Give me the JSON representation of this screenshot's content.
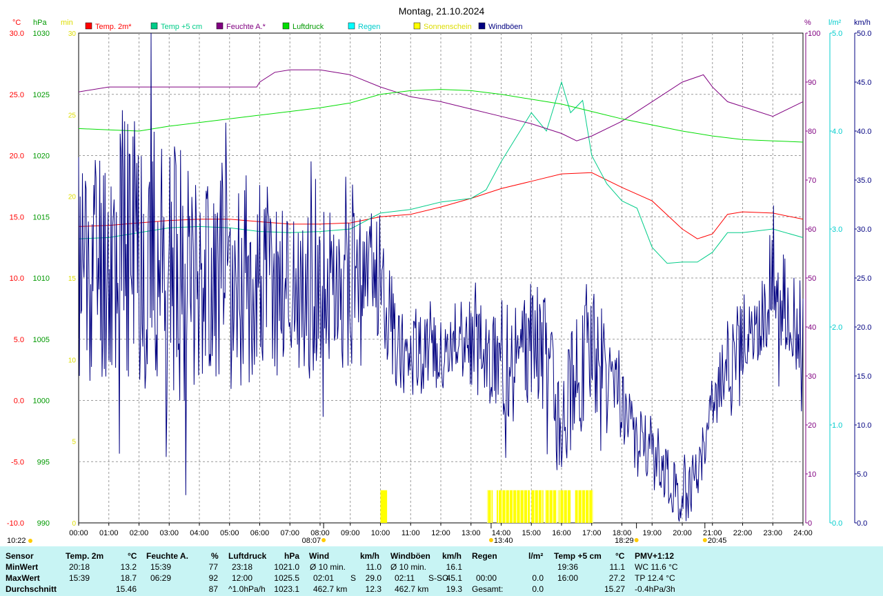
{
  "chart_data": {
    "type": "line",
    "title": "Montag, 21.10.2024",
    "x_ticks": [
      "00:00",
      "01:00",
      "02:00",
      "03:00",
      "04:00",
      "05:00",
      "06:00",
      "07:00",
      "08:00",
      "09:00",
      "10:00",
      "11:00",
      "12:00",
      "13:00",
      "14:00",
      "15:00",
      "16:00",
      "17:00",
      "18:00",
      "19:00",
      "20:00",
      "21:00",
      "22:00",
      "23:00",
      "24:00"
    ],
    "axes": {
      "temp": {
        "unit": "°C",
        "range": [
          -10,
          30
        ],
        "ticks": [
          "-10.0",
          "-5.0",
          "0.0",
          "5.0",
          "10.0",
          "15.0",
          "20.0",
          "25.0",
          "30.0"
        ],
        "color": "#ff0000"
      },
      "pressure": {
        "unit": "hPa",
        "range": [
          990,
          1030
        ],
        "ticks": [
          "990",
          "995",
          "1000",
          "1005",
          "1010",
          "1015",
          "1020",
          "1025",
          "1030"
        ],
        "color": "#009900"
      },
      "sunshine": {
        "unit": "min",
        "range": [
          0,
          30
        ],
        "ticks": [
          "0",
          "5",
          "10",
          "15",
          "20",
          "25",
          "30"
        ],
        "color": "#dddd00"
      },
      "humidity": {
        "unit": "%",
        "range": [
          0,
          100
        ],
        "ticks": [
          "0",
          "10",
          "20",
          "30",
          "40",
          "50",
          "60",
          "70",
          "80",
          "90",
          "100"
        ],
        "color": "#800080"
      },
      "rain": {
        "unit": "l/m²",
        "range": [
          0,
          5
        ],
        "ticks": [
          "0.0",
          "1.0",
          "2.0",
          "3.0",
          "4.0",
          "5.0"
        ],
        "color": "#00cccc"
      },
      "wind": {
        "unit": "km/h",
        "range": [
          0,
          50
        ],
        "ticks": [
          "0.0",
          "5.0",
          "10.0",
          "15.0",
          "20.0",
          "25.0",
          "30.0",
          "35.0",
          "40.0",
          "45.0",
          "50.0"
        ],
        "color": "#000080"
      }
    },
    "legend": [
      {
        "name": "Temp. 2m*",
        "color": "#ff0000"
      },
      {
        "name": "Temp +5 cm",
        "color": "#00cc88"
      },
      {
        "name": "Feuchte A.*",
        "color": "#800080"
      },
      {
        "name": "Luftdruck",
        "color": "#00dd00"
      },
      {
        "name": "Regen",
        "color": "#00ffff"
      },
      {
        "name": "Sonnenschein",
        "color": "#ffff00"
      },
      {
        "name": "Windböen",
        "color": "#000080"
      }
    ],
    "series": [
      {
        "name": "Temp. 2m*",
        "axis": "temp",
        "color": "#ff0000",
        "x": [
          0,
          1,
          2,
          3,
          4,
          5,
          6,
          7,
          8,
          9,
          10,
          11,
          12,
          13,
          14,
          15,
          16,
          17,
          18,
          19,
          20,
          20.5,
          21,
          21.5,
          22,
          23,
          24
        ],
        "y": [
          14.2,
          14.3,
          14.5,
          14.7,
          14.8,
          14.8,
          14.6,
          14.4,
          14.4,
          14.5,
          15.0,
          15.2,
          15.8,
          16.5,
          17.3,
          17.9,
          18.5,
          18.6,
          17.4,
          16.3,
          14.0,
          13.2,
          13.6,
          15.2,
          15.4,
          15.3,
          14.8
        ]
      },
      {
        "name": "Temp +5 cm",
        "axis": "temp",
        "color": "#00cc88",
        "x": [
          0,
          1,
          2,
          3,
          4,
          5,
          6,
          7,
          8,
          9,
          10,
          11,
          12,
          13,
          13.5,
          14,
          14.5,
          15,
          15.5,
          16,
          16.3,
          16.7,
          17,
          17.5,
          18,
          18.5,
          19,
          19.5,
          20,
          20.5,
          21,
          21.5,
          22,
          23,
          24
        ],
        "y": [
          13.2,
          13.3,
          13.7,
          14.1,
          14.2,
          14.1,
          13.8,
          13.7,
          13.8,
          14.0,
          15.3,
          15.6,
          16.2,
          16.5,
          17.2,
          19.5,
          21.5,
          23.5,
          22,
          26,
          23.5,
          24.5,
          20,
          17.7,
          16.3,
          15.7,
          12.5,
          11.2,
          11.3,
          11.3,
          12.1,
          13.7,
          13.7,
          14.0,
          13.3
        ]
      },
      {
        "name": "Feuchte A.*",
        "axis": "humidity",
        "color": "#800080",
        "x": [
          0,
          1,
          1.9,
          3,
          4,
          5,
          5.9,
          6,
          6.5,
          7,
          8,
          9,
          10,
          11,
          12,
          13,
          14,
          15,
          16,
          16.5,
          17,
          18,
          19,
          20,
          20.7,
          21,
          21.5,
          22,
          23,
          24
        ],
        "y": [
          88,
          89,
          89,
          89,
          89,
          89,
          89,
          90,
          92,
          92.5,
          92.5,
          91.5,
          89,
          87,
          86,
          84.5,
          83,
          81.5,
          79.5,
          78,
          79,
          82,
          86,
          90,
          91.5,
          89,
          86,
          85,
          83,
          86
        ]
      },
      {
        "name": "Luftdruck",
        "axis": "pressure",
        "color": "#00dd00",
        "x": [
          0,
          1,
          2,
          3,
          4,
          5,
          6,
          7,
          8,
          9,
          10,
          11,
          12,
          13,
          14,
          15,
          16,
          17,
          18,
          19,
          20,
          21,
          22,
          23,
          24
        ],
        "y": [
          1022.2,
          1022.1,
          1022.0,
          1022.4,
          1022.7,
          1023.0,
          1023.3,
          1023.6,
          1023.9,
          1024.3,
          1025.0,
          1025.3,
          1025.4,
          1025.3,
          1025.0,
          1024.6,
          1024.2,
          1023.6,
          1023.0,
          1022.5,
          1022.0,
          1021.6,
          1021.3,
          1021.2,
          1021.1
        ]
      },
      {
        "name": "Windböen",
        "axis": "wind",
        "color": "#000080",
        "x": [
          0,
          0.5,
          1,
          1.5,
          2,
          2.5,
          3,
          3.5,
          4,
          4.5,
          5,
          5.5,
          6,
          6.5,
          7,
          7.5,
          8,
          8.5,
          9,
          9.5,
          10,
          10.5,
          11,
          11.5,
          12,
          12.5,
          13,
          13.5,
          14,
          14.5,
          15,
          15.5,
          16,
          16.5,
          17,
          17.5,
          18,
          18.5,
          19,
          19.5,
          20,
          20.5,
          21,
          21.5,
          22,
          22.5,
          23,
          23.5,
          24
        ],
        "y": [
          26,
          27,
          27,
          28,
          29,
          27,
          26,
          25,
          26,
          25,
          24,
          25,
          25,
          24,
          24,
          23,
          24,
          23,
          24,
          25,
          26,
          18,
          18,
          17,
          18,
          19,
          18,
          17,
          17,
          16,
          19,
          17,
          12,
          15,
          19,
          14,
          12,
          8,
          8,
          5,
          2,
          5,
          12,
          17,
          19,
          19,
          25,
          21,
          20
        ],
        "jitter": [
          14,
          13,
          13,
          15,
          17,
          14,
          13,
          13,
          11,
          11,
          11,
          11,
          11,
          10,
          10,
          9,
          9,
          8,
          8,
          7,
          7,
          5,
          5,
          4,
          4,
          4,
          5,
          5,
          6,
          6,
          6,
          6,
          7,
          7,
          7,
          6,
          4,
          4,
          3,
          3,
          3,
          3,
          3,
          4,
          4,
          4,
          6,
          5,
          5
        ]
      }
    ],
    "sunshine_blocks_hours": [
      [
        10.0,
        10.22
      ],
      [
        13.53,
        13.72
      ],
      [
        13.85,
        14.95
      ],
      [
        15.0,
        15.4
      ],
      [
        15.45,
        15.85
      ],
      [
        15.9,
        16.3
      ],
      [
        16.45,
        17.05
      ]
    ],
    "sunshine_block_value": 2,
    "markers": [
      {
        "label": "08:07",
        "hour": 8.117
      },
      {
        "label": "13:40",
        "hour": 13.667
      },
      {
        "label": "18:29",
        "hour": 18.483
      },
      {
        "label": "20:45",
        "hour": 20.75
      }
    ],
    "corner_time": "10:22"
  },
  "stats": {
    "row_labels": [
      "Sensor",
      "MinWert",
      "MaxWert",
      "Durchschnitt"
    ],
    "temp2m": {
      "header": "Temp. 2m",
      "unit": "°C",
      "min_time": "20:18",
      "min": "13.2",
      "max_time": "15:39",
      "max": "18.7",
      "avg": "15.46"
    },
    "humidity": {
      "header": "Feuchte A.",
      "unit": "%",
      "min_time": "15:39",
      "min": "77",
      "max_time": "06:29",
      "max": "92",
      "avg": "87"
    },
    "pressure": {
      "header": "Luftdruck",
      "unit": "hPa",
      "min_time": "23:18",
      "min": "1021.0",
      "max_time": "12:00",
      "max": "1025.5",
      "trend": "^1.0hPa/h",
      "avg": "1023.1"
    },
    "wind": {
      "header": "Wind",
      "unit": "km/h",
      "r1_label": "Ø 10 min.",
      "r1": "11.0",
      "r2_time": "02:01",
      "r2_dir": "S",
      "r2": "29.0",
      "r3_dist": "462.7 km",
      "r3": "12.3"
    },
    "gusts": {
      "header": "Windböen",
      "unit": "km/h",
      "r1_label": "Ø 10 min.",
      "r1": "16.1",
      "r2_time": "02:11",
      "r2_dir": "S-SO",
      "r2": "45.1",
      "r3_dist": "462.7 km",
      "r3": "19.3"
    },
    "rain": {
      "header": "Regen",
      "unit": "l/m²",
      "r2_time": "00:00",
      "r2": "0.0",
      "r3_label": "Gesamt:",
      "r3": "0.0"
    },
    "temp5cm": {
      "header": "Temp +5 cm",
      "unit": "°C",
      "min_time": "19:36",
      "min": "11.1",
      "max_time": "16:00",
      "max": "27.2",
      "avg": "15.27"
    },
    "pmv": {
      "header": "PMV+1:12",
      "r1": "WC 11.6 °C",
      "r2": "TP 12.4 °C",
      "r3": "-0.4hPa/3h"
    }
  }
}
